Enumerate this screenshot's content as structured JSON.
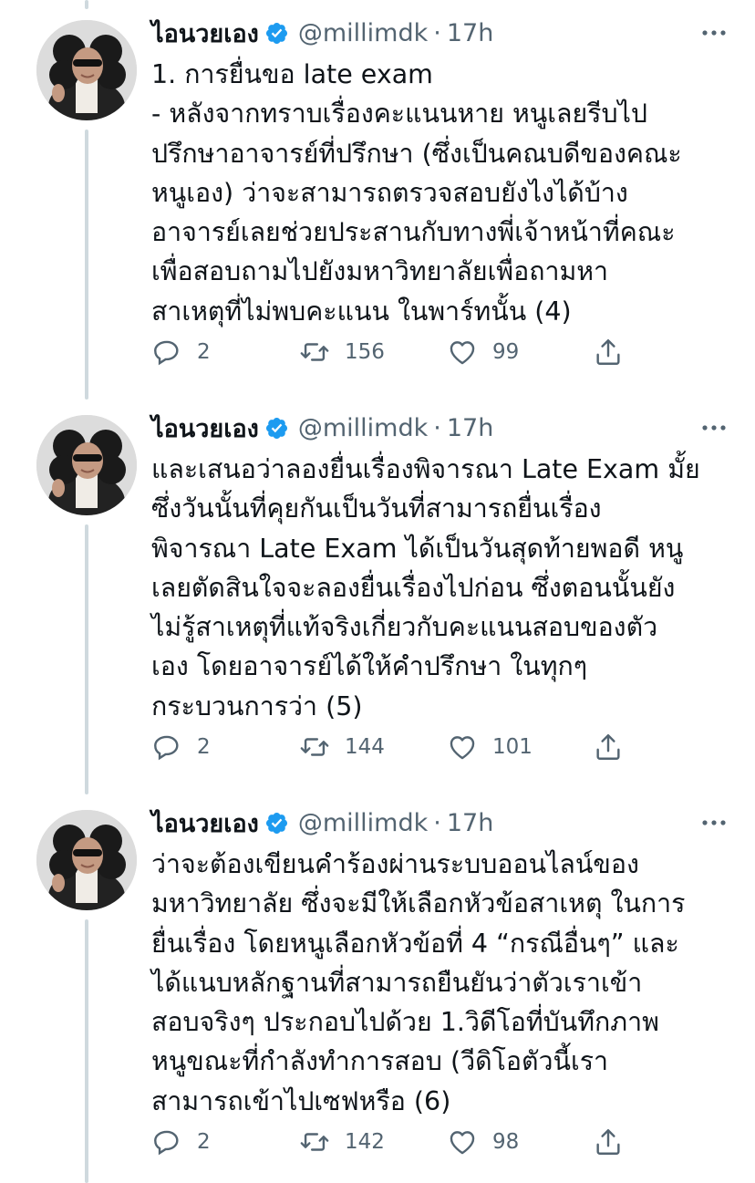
{
  "tweets": [
    {
      "author": "ไอนวยเอง",
      "handle": "@millimdk",
      "separator": "·",
      "time": "17h",
      "lines": [
        "1. การยื่นขอ late exam",
        "- หลังจากทราบเรื่องคะแนนหาย หนูเลยรีบไป",
        "ปรึกษาอาจารย์ที่ปรึกษา (ซึ่งเป็นคณบดีของคณะ",
        "หนูเอง) ว่าจะสามารถตรวจสอบยังไงได้บ้าง",
        "อาจารย์เลยช่วยประสานกับทางพี่เจ้าหน้าที่คณะ",
        "เพื่อสอบถามไปยังมหาวิทยาลัยเพื่อถามหา",
        "สาเหตุที่ไม่พบคะแนน ในพาร์ทนั้น (4)"
      ],
      "replies": "2",
      "retweets": "156",
      "likes": "99"
    },
    {
      "author": "ไอนวยเอง",
      "handle": "@millimdk",
      "separator": "·",
      "time": "17h",
      "lines": [
        "และเสนอว่าลองยื่นเรื่องพิจารณา Late Exam มั้ย",
        "ซึ่งวันนั้นที่คุยกันเป็นวันที่สามารถยื่นเรื่อง",
        "พิจารณา Late Exam ได้เป็นวันสุดท้ายพอดี หนู",
        "เลยตัดสินใจจะลองยื่นเรื่องไปก่อน ซึ่งตอนนั้นยัง",
        "ไม่รู้สาเหตุที่แท้จริงเกี่ยวกับคะแนนสอบของตัว",
        "เอง โดยอาจารย์ได้ให้คำปรึกษา ในทุกๆ",
        "กระบวนการว่า (5)"
      ],
      "replies": "2",
      "retweets": "144",
      "likes": "101"
    },
    {
      "author": "ไอนวยเอง",
      "handle": "@millimdk",
      "separator": "·",
      "time": "17h",
      "lines": [
        "ว่าจะต้องเขียนคำร้องผ่านระบบออนไลน์ของ",
        "มหาวิทยาลัย ซึ่งจะมีให้เลือกหัวข้อสาเหตุ ในการ",
        "ยื่นเรื่อง โดยหนูเลือกหัวข้อที่ 4 “กรณีอื่นๆ”  และ",
        "ได้แนบหลักฐานที่สามารถยืนยันว่าตัวเราเข้า",
        "สอบจริงๆ ประกอบไปด้วย 1.วิดีโอที่บันทึกภาพ",
        "หนูขณะที่กำลังทำการสอบ (วีดิโอตัวนี้เรา",
        "สามารถเข้าไปเซฟหรือ (6)"
      ],
      "replies": "2",
      "retweets": "142",
      "likes": "98"
    }
  ],
  "colors": {
    "verified": "#1d9bf0",
    "secondary_text": "#536471",
    "thread_line": "#cfd9de"
  },
  "icons": [
    "verified-badge-icon",
    "more-options-icon",
    "reply-icon",
    "retweet-icon",
    "like-icon",
    "share-icon"
  ]
}
